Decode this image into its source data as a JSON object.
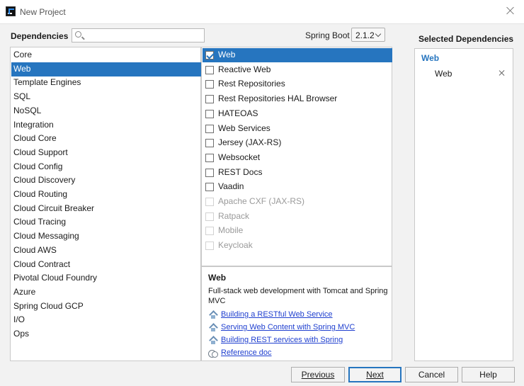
{
  "window": {
    "title": "New Project"
  },
  "dependencies": {
    "label": "Dependencies",
    "search_placeholder": "",
    "search_value": ""
  },
  "spring_boot": {
    "label": "Spring Boot",
    "selected_version": "2.1.2"
  },
  "categories": [
    "Core",
    "Web",
    "Template Engines",
    "SQL",
    "NoSQL",
    "Integration",
    "Cloud Core",
    "Cloud Support",
    "Cloud Config",
    "Cloud Discovery",
    "Cloud Routing",
    "Cloud Circuit Breaker",
    "Cloud Tracing",
    "Cloud Messaging",
    "Cloud AWS",
    "Cloud Contract",
    "Pivotal Cloud Foundry",
    "Azure",
    "Spring Cloud GCP",
    "I/O",
    "Ops"
  ],
  "selected_category": "Web",
  "dependency_items": [
    {
      "label": "Web",
      "checked": true,
      "enabled": true
    },
    {
      "label": "Reactive Web",
      "checked": false,
      "enabled": true
    },
    {
      "label": "Rest Repositories",
      "checked": false,
      "enabled": true
    },
    {
      "label": "Rest Repositories HAL Browser",
      "checked": false,
      "enabled": true
    },
    {
      "label": "HATEOAS",
      "checked": false,
      "enabled": true
    },
    {
      "label": "Web Services",
      "checked": false,
      "enabled": true
    },
    {
      "label": "Jersey (JAX-RS)",
      "checked": false,
      "enabled": true
    },
    {
      "label": "Websocket",
      "checked": false,
      "enabled": true
    },
    {
      "label": "REST Docs",
      "checked": false,
      "enabled": true
    },
    {
      "label": "Vaadin",
      "checked": false,
      "enabled": true
    },
    {
      "label": "Apache CXF (JAX-RS)",
      "checked": false,
      "enabled": false
    },
    {
      "label": "Ratpack",
      "checked": false,
      "enabled": false
    },
    {
      "label": "Mobile",
      "checked": false,
      "enabled": false
    },
    {
      "label": "Keycloak",
      "checked": false,
      "enabled": false
    }
  ],
  "description": {
    "title": "Web",
    "text": "Full-stack web development with Tomcat and Spring MVC",
    "links": [
      {
        "label": "Building a RESTful Web Service",
        "icon": "home-icon"
      },
      {
        "label": "Serving Web Content with Spring MVC",
        "icon": "home-icon"
      },
      {
        "label": "Building REST services with Spring",
        "icon": "home-icon"
      },
      {
        "label": "Reference doc",
        "icon": "reference-doc-icon"
      }
    ]
  },
  "selected_dependencies": {
    "label": "Selected Dependencies",
    "group": "Web",
    "items": [
      "Web"
    ]
  },
  "buttons": {
    "previous_label": "Previous",
    "next_label": "Next",
    "cancel_label": "Cancel",
    "help_label": "Help"
  },
  "colors": {
    "selection": "#2675bf",
    "link": "#1f3fcf",
    "disabled_text": "#9a9a9a"
  }
}
